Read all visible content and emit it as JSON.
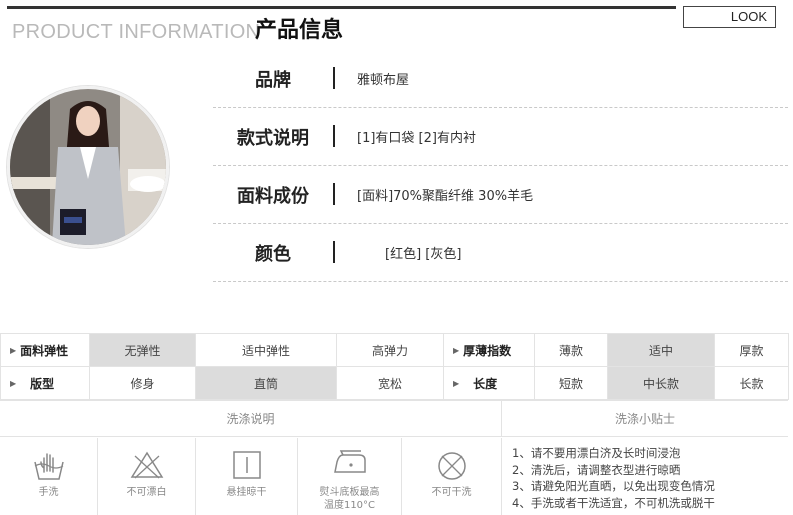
{
  "header": {
    "title_en": "PRODUCT INFORMATION",
    "title_cn": "产品信息",
    "look_button": "LOOK"
  },
  "product_info": [
    {
      "label": "品牌",
      "value": "雅顿布屋"
    },
    {
      "label": "款式说明",
      "value": "[1]有口袋 [2]有内衬"
    },
    {
      "label": "面料成份",
      "value": "[面料]70%聚酯纤维 30%羊毛"
    },
    {
      "label": "颜色",
      "value": "[红色]  [灰色]"
    }
  ],
  "attributes": {
    "rows": [
      {
        "left_label": "面料弹性",
        "left_options": [
          "无弹性",
          "适中弹性",
          "高弹力"
        ],
        "left_selected": 0,
        "right_label": "厚薄指数",
        "right_options": [
          "薄款",
          "适中",
          "厚款"
        ],
        "right_selected": 1
      },
      {
        "left_label": "版型",
        "left_options": [
          "修身",
          "直筒",
          "宽松"
        ],
        "left_selected": 1,
        "right_label": "长度",
        "right_options": [
          "短款",
          "中长款",
          "长款"
        ],
        "right_selected": 1
      }
    ]
  },
  "wash": {
    "instructions_title": "洗涤说明",
    "tips_title": "洗涤小贴士",
    "icons": [
      {
        "icon": "hand-wash-icon",
        "label": "手洗"
      },
      {
        "icon": "no-bleach-icon",
        "label": "不可漂白"
      },
      {
        "icon": "hang-dry-icon",
        "label": "悬挂晾干"
      },
      {
        "icon": "iron-icon",
        "label_line1": "熨斗底板最高",
        "label_line2": "温度110°C"
      },
      {
        "icon": "no-dry-clean-icon",
        "label": "不可干洗"
      }
    ],
    "tips": [
      "1、请不要用漂白济及长时间浸泡",
      "2、清洗后，请调整衣型进行晾晒",
      "3、请避免阳光直晒，以免出现变色情况",
      "4、手洗或者干洗适宜，不可机洗或脱干"
    ]
  },
  "colors": {
    "selected_cell": "#dcdcdc",
    "border": "#e3e3e3",
    "header_en": "#b9b9b9"
  }
}
